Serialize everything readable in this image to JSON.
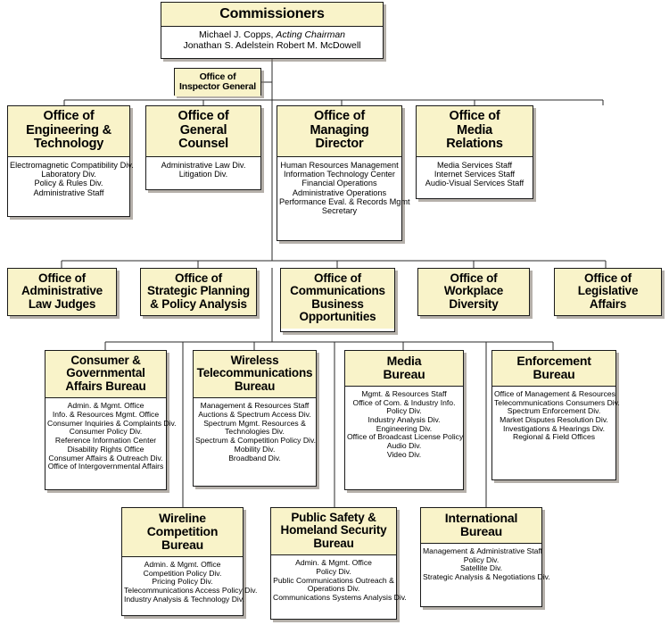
{
  "colors": {
    "header_fill": "#f9f3c9",
    "body_fill": "#ffffff",
    "border": "#1a1a1a",
    "shadow": "#787064"
  },
  "root": {
    "title": "Commissioners",
    "members": [
      {
        "name": "Michael J. Copps, ",
        "role": "Acting Chairman"
      },
      {
        "name": "Jonathan S. Adelstein   Robert M. McDowell",
        "role": ""
      }
    ],
    "line1_name": "Michael J. Copps,",
    "line1_role": "Acting Chairman",
    "line2": "Jonathan S. Adelstein   Robert M. McDowell"
  },
  "inspector_general": {
    "title_line1": "Office of",
    "title_line2": "Inspector General"
  },
  "row2": [
    {
      "title": "Office of\nEngineering &\nTechnology",
      "items": [
        "Electromagnetic Compatibility Div.",
        "Laboratory Div.",
        "Policy & Rules Div.",
        "Administrative Staff"
      ]
    },
    {
      "title": "Office of\nGeneral\nCounsel",
      "items": [
        "Administrative Law Div.",
        "Litigation Div."
      ]
    },
    {
      "title": "Office of\nManaging\nDirector",
      "items": [
        "Human Resources Management",
        "Information Technology Center",
        "Financial Operations",
        "Administrative Operations",
        "Performance Eval. & Records Mgmt",
        "Secretary"
      ]
    },
    {
      "title": "Office of\nMedia\nRelations",
      "items": [
        "Media Services Staff",
        "Internet Services Staff",
        "Audio-Visual Services Staff"
      ]
    }
  ],
  "row3": [
    {
      "title": "Office of\nAdministrative\nLaw Judges",
      "items": []
    },
    {
      "title": "Office of\nStrategic Planning\n& Policy Analysis",
      "items": []
    },
    {
      "title": "Office of\nCommunications\nBusiness\nOpportunities",
      "items": []
    },
    {
      "title": "Office of\nWorkplace\nDiversity",
      "items": []
    },
    {
      "title": "Office of\nLegislative\nAffairs",
      "items": []
    }
  ],
  "row4": [
    {
      "title": "Consumer &\nGovernmental\nAffairs Bureau",
      "items": [
        "Admin. & Mgmt. Office",
        "Info. & Resources Mgmt. Office",
        "Consumer Inquiries & Complaints Div.",
        "Consumer Policy Div.",
        "Reference Information Center",
        "Disability Rights Office",
        "Consumer Affairs & Outreach Div.",
        "Office of Intergovernmental Affairs"
      ]
    },
    {
      "title": "Wireless\nTelecommunications\nBureau",
      "items": [
        "Management & Resources Staff",
        "Auctions & Spectrum Access Div.",
        "Spectrum Mgmt. Resources &",
        "Technologies Div.",
        "Spectrum & Competition Policy Div.",
        "Mobility Div.",
        "Broadband Div."
      ]
    },
    {
      "title": "Media\nBureau",
      "items": [
        "Mgmt. & Resources Staff",
        "Office of Com. & Industry Info.",
        "Policy Div.",
        "Industry Analysis Div.",
        "Engineering Div.",
        "Office of Broadcast License Policy",
        "Audio Div.",
        "Video Div."
      ]
    },
    {
      "title": "Enforcement\nBureau",
      "items": [
        "Office of Management & Resources",
        "Telecommunications Consumers Div.",
        "Spectrum Enforcement Div.",
        "Market Disputes Resolution Div.",
        "Investigations & Hearings Div.",
        "Regional & Field Offices"
      ]
    }
  ],
  "row5": [
    {
      "title": "Wireline\nCompetition\nBureau",
      "items": [
        "Admin. & Mgmt. Office",
        "Competition Policy Div.",
        "Pricing Policy Div.",
        "Telecommunications Access Policy Div.",
        "Industry Analysis & Technology Div."
      ]
    },
    {
      "title": "Public Safety &\nHomeland Security\nBureau",
      "items": [
        "Admin. & Mgmt. Office",
        "Policy Div.",
        "Public Communications Outreach &",
        "Operations Div.",
        "Communications Systems Analysis Div."
      ]
    },
    {
      "title": "International\nBureau",
      "items": [
        "Management & Administrative Staff",
        "Policy Div.",
        "Satellite Div.",
        "Strategic Analysis & Negotiations Div."
      ]
    }
  ]
}
